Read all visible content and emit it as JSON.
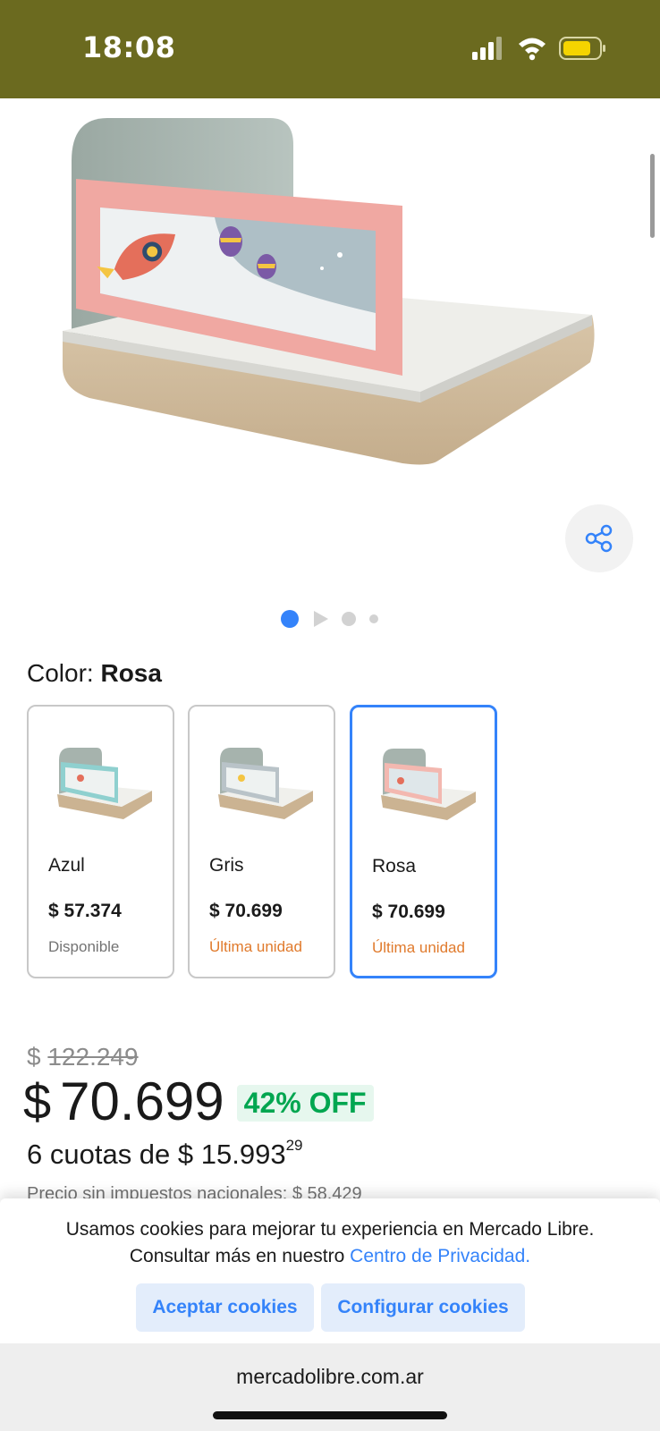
{
  "status_bar": {
    "time": "18:08",
    "icons": [
      "signal-icon",
      "wifi-icon",
      "battery-icon"
    ],
    "background": "#6b6a1f"
  },
  "product": {
    "image_icon": "bed-rail-image",
    "share_icon": "share-icon",
    "gallery": {
      "total": 4,
      "active_index": 0,
      "has_video": true
    }
  },
  "color_selector": {
    "label": "Color:",
    "selected": "Rosa",
    "variants": [
      {
        "name": "Azul",
        "price": "$ 57.374",
        "stock": "Disponible",
        "panel_color": "#8fd0cf"
      },
      {
        "name": "Gris",
        "price": "$ 70.699",
        "stock": "Última unidad",
        "panel_color": "#b9c3c8"
      },
      {
        "name": "Rosa",
        "price": "$ 70.699",
        "stock": "Última unidad",
        "panel_color": "#f3b8b0"
      }
    ]
  },
  "pricing": {
    "old_currency": "$",
    "old_price": "122.249",
    "currency": "$",
    "price": "70.699",
    "discount": "42% OFF",
    "installments_text": "6 cuotas de $ 15.993",
    "installments_cents": "29",
    "no_tax_text": "Precio sin impuestos nacionales: $ 58.429"
  },
  "cookie_banner": {
    "line1": "Usamos cookies para mejorar tu experiencia en Mercado Libre.",
    "line2_prefix": "Consultar más en nuestro",
    "link": "Centro de Privacidad.",
    "accept": "Aceptar cookies",
    "configure": "Configurar cookies"
  },
  "browser": {
    "url": "mercadolibre.com.ar"
  },
  "colors": {
    "accent": "#3483fa",
    "discount_green": "#00a650",
    "last_unit_orange": "#e07a2c"
  }
}
